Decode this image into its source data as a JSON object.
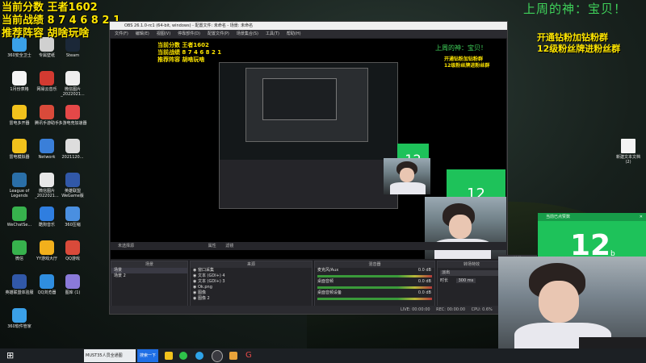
{
  "overlay": {
    "score_line": "当前分数 王者1602",
    "record_line": "当前战绩 8 7 4 6 8 2 1",
    "recommend_line": "推荐阵容 胡啥玩啥",
    "weekly_god": "上周的神：宝贝！",
    "fan_line1": "开通钻粉加钻粉群",
    "fan_line2": "12级粉丝牌进粉丝群",
    "counter": "12",
    "counter_small": "b",
    "counter_header": "当前已点赞数"
  },
  "desktop_icons": [
    {
      "label": "360安全卫士",
      "color": "#3aa0e8"
    },
    {
      "label": "专属壁纸",
      "color": "#d0d0d0"
    },
    {
      "label": "Steam",
      "color": "#1b2838"
    },
    {
      "label": "1月份表格",
      "color": "#f5f5f5"
    },
    {
      "label": "网易云音乐",
      "color": "#d33a31"
    },
    {
      "label": "微信图片_2022021...",
      "color": "#eeeeee"
    },
    {
      "label": "雷电多开器",
      "color": "#f2c21c"
    },
    {
      "label": "腾讯手游助手",
      "color": "#d94a3a"
    },
    {
      "label": "多游电竞加速器",
      "color": "#e54848"
    },
    {
      "label": "雷电模拟器",
      "color": "#f2c21c"
    },
    {
      "label": "Network",
      "color": "#3a7fd9"
    },
    {
      "label": "2021120...",
      "color": "#dddddd"
    },
    {
      "label": "League of Legends",
      "color": "#2a6fa8"
    },
    {
      "label": "微信图片_2022021...",
      "color": "#e7e7e7"
    },
    {
      "label": "英雄联盟WeGame版",
      "color": "#3158a8"
    },
    {
      "label": "WeChatSe...",
      "color": "#37b24d"
    },
    {
      "label": "酷狗音乐",
      "color": "#2f7ee0"
    },
    {
      "label": "360压缩",
      "color": "#4a8fe0"
    },
    {
      "label": "微信",
      "color": "#37b24d"
    },
    {
      "label": "YY游戏大厅",
      "color": "#f2b01c"
    },
    {
      "label": "QQ游戏",
      "color": "#d94a3a"
    },
    {
      "label": "英雄联盟体验服",
      "color": "#3158a8"
    },
    {
      "label": "QQ浏览器",
      "color": "#2f8ee0"
    },
    {
      "label": "图库 (1)",
      "color": "#8a7ad9"
    },
    {
      "label": "360软件管家",
      "color": "#3aa0e8"
    }
  ],
  "right_icon": {
    "label": "新建文本文档 (2)"
  },
  "obs": {
    "title": "OBS 26.1.0-rc1 (64-bit, windows) - 配置文件: 未命名 - 场景: 未命名",
    "menus": [
      "文件(F)",
      "编辑(E)",
      "视图(V)",
      "停靠部件(D)",
      "配置文件(P)",
      "场景集合(S)",
      "工具(T)",
      "帮助(H)"
    ],
    "status_label": "未选择源",
    "properties_btn": "属性",
    "filters_btn": "滤镜",
    "panels": {
      "scenes": "场景",
      "sources": "来源",
      "mixer": "混音器",
      "transitions": "转场特效",
      "controls": "控件"
    },
    "scenes": [
      "场景",
      "场景 2"
    ],
    "sources": [
      "窗口采集",
      "文本 (GDI+) 4",
      "文本 (GDI+) 3",
      "Ok.png",
      "图像",
      "图像 2"
    ],
    "mixer": [
      {
        "label": "麦克风/Aux",
        "db": "0.0 dB"
      },
      {
        "label": "桌面音频",
        "db": "0.0 dB"
      },
      {
        "label": "桌面音频设备",
        "db": "0.0 dB"
      }
    ],
    "transition": "淡出",
    "duration_label": "时长",
    "duration_value": "300 ms",
    "status": {
      "live": "LIVE: 00:00:00",
      "rec": "REC: 00:00:00",
      "cpu": "CPU: 0.6%",
      "fps": "30.00 fps"
    }
  },
  "taskbar": {
    "window_title": "MUST35人员全通图",
    "search_label": "搜索一下"
  }
}
